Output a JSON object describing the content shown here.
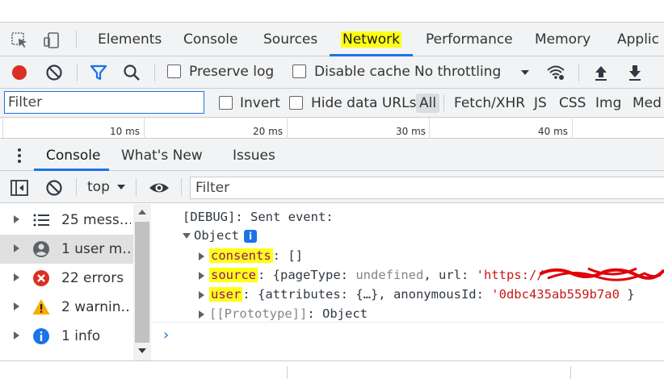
{
  "main_tabs": [
    "Elements",
    "Console",
    "Sources",
    "Network",
    "Performance",
    "Memory",
    "Applic"
  ],
  "network_toolbar": {
    "preserve_log": "Preserve log",
    "disable_cache": "Disable cache",
    "throttling": "No throttling"
  },
  "filter_bar": {
    "filter_placeholder": "Filter",
    "invert": "Invert",
    "hide_data_urls": "Hide data URLs",
    "types": [
      "All",
      "Fetch/XHR",
      "JS",
      "CSS",
      "Img",
      "Med"
    ]
  },
  "timeline": {
    "ticks": [
      "10 ms",
      "20 ms",
      "30 ms",
      "40 ms"
    ]
  },
  "drawer_tabs": [
    "Console",
    "What's New",
    "Issues"
  ],
  "console_toolbar": {
    "context": "top",
    "filter_placeholder": "Filter"
  },
  "sidebar": {
    "items": [
      {
        "label": "25 mess…",
        "icon": "list-icon"
      },
      {
        "label": "1 user m…",
        "icon": "user-icon"
      },
      {
        "label": "22 errors",
        "icon": "error-icon"
      },
      {
        "label": "2 warnin…",
        "icon": "warning-icon"
      },
      {
        "label": "1 info",
        "icon": "info-icon"
      }
    ]
  },
  "console": {
    "debug_line": "[DEBUG]: Sent event:",
    "object_label": "Object",
    "props": [
      {
        "key": "consents",
        "value": "[]"
      },
      {
        "key": "source",
        "value_prefix": "{pageType: ",
        "value_undefined": "undefined",
        "value_mid": ", url: ",
        "value_str": "'https://"
      },
      {
        "key": "user",
        "value_prefix": "{attributes: {…}, anonymousId: ",
        "value_str": "'0dbc435ab559b7a0",
        "value_suffix": " }"
      },
      {
        "key": "[[Prototype]]",
        "value": "Object"
      }
    ]
  },
  "colors": {
    "accent": "#1a73e8",
    "highlight": "#ffff14",
    "record": "#d93025",
    "error": "#d93025",
    "warning": "#f9ab00"
  }
}
